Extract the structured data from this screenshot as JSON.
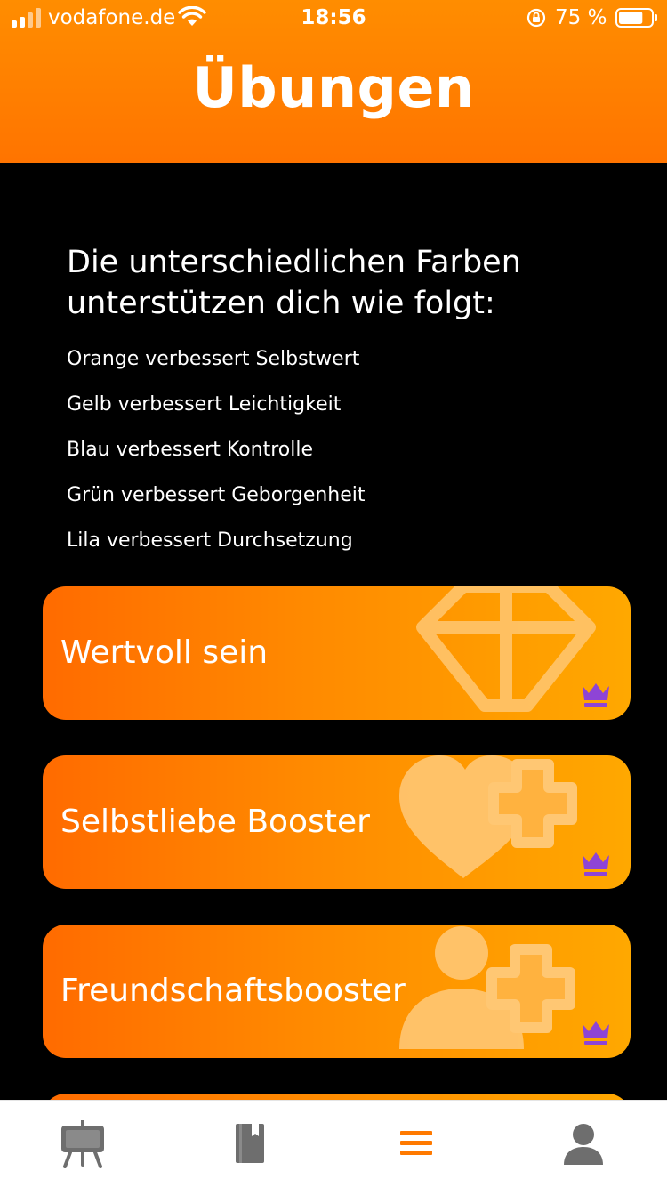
{
  "status_bar": {
    "carrier": "vodafone.de",
    "time": "18:56",
    "battery_percent": "75 %",
    "battery_level": 0.75
  },
  "header": {
    "title": "Übungen"
  },
  "info": {
    "heading": "Die unterschiedlichen Farben unterstützen dich wie folgt:",
    "items": [
      "Orange verbessert Selbstwert",
      "Gelb verbessert Leichtigkeit",
      "Blau verbessert Kontrolle",
      "Grün verbessert Geborgenheit",
      "Lila verbessert Durchsetzung"
    ]
  },
  "cards": [
    {
      "label": "Wertvoll sein",
      "icon": "diamond-icon",
      "premium": true
    },
    {
      "label": "Selbstliebe Booster",
      "icon": "heart-plus-icon",
      "premium": true
    },
    {
      "label": "Freundschaftsbooster",
      "icon": "person-plus-icon",
      "premium": true
    }
  ],
  "tabbar": {
    "tabs": [
      {
        "name": "easel-icon",
        "active": false
      },
      {
        "name": "book-icon",
        "active": false
      },
      {
        "name": "menu-icon",
        "active": true
      },
      {
        "name": "profile-icon",
        "active": false
      }
    ]
  },
  "colors": {
    "accent": "#ff7a00",
    "crown": "#8e44d6",
    "card_gradient_start": "#ff6b00",
    "card_gradient_end": "#ffa800",
    "tab_inactive": "#6e6e6e"
  }
}
